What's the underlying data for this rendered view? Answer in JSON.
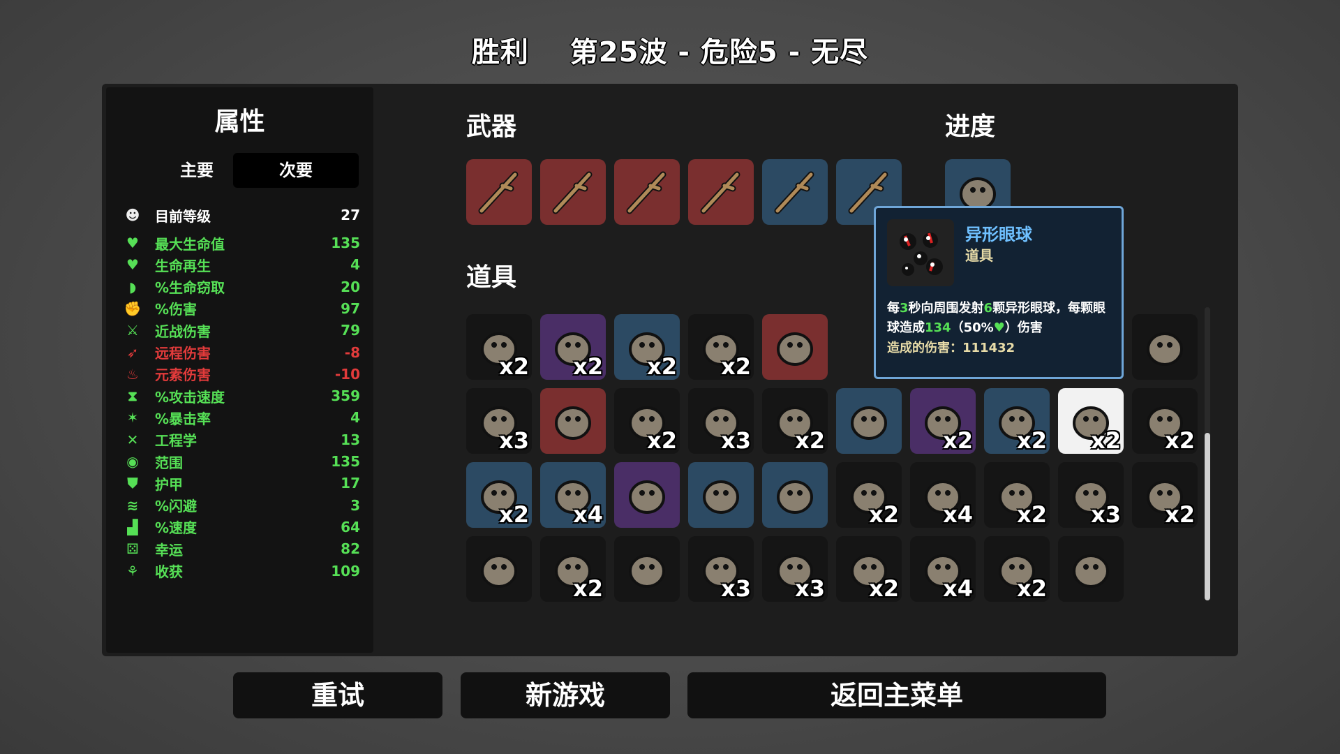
{
  "header": {
    "result": "胜利",
    "wave_info": "第25波 - 危险5 - 无尽"
  },
  "stats_panel": {
    "title": "属性",
    "tabs": [
      "主要",
      "次要"
    ],
    "rows": [
      {
        "name": "目前等级",
        "value": "27",
        "color": "#ffffff",
        "icon": "level-icon"
      },
      {
        "name": "最大生命值",
        "value": "135",
        "color": "#56e056",
        "icon": "heart-icon"
      },
      {
        "name": "生命再生",
        "value": "4",
        "color": "#56e056",
        "icon": "heart-plus-icon"
      },
      {
        "name": "%生命窃取",
        "value": "20",
        "color": "#56e056",
        "icon": "fangs-icon"
      },
      {
        "name": "%伤害",
        "value": "97",
        "color": "#56e056",
        "icon": "muscle-icon"
      },
      {
        "name": "近战伤害",
        "value": "79",
        "color": "#56e056",
        "icon": "sword-icon"
      },
      {
        "name": "远程伤害",
        "value": "-8",
        "color": "#e23b3b",
        "icon": "bow-icon"
      },
      {
        "name": "元素伤害",
        "value": "-10",
        "color": "#e23b3b",
        "icon": "fire-icon"
      },
      {
        "name": "%攻击速度",
        "value": "359",
        "color": "#56e056",
        "icon": "hourglass-icon"
      },
      {
        "name": "%暴击率",
        "value": "4",
        "color": "#56e056",
        "icon": "crit-icon"
      },
      {
        "name": "工程学",
        "value": "13",
        "color": "#56e056",
        "icon": "wrench-icon"
      },
      {
        "name": "范围",
        "value": "135",
        "color": "#56e056",
        "icon": "range-icon"
      },
      {
        "name": "护甲",
        "value": "17",
        "color": "#56e056",
        "icon": "shield-icon"
      },
      {
        "name": "%闪避",
        "value": "3",
        "color": "#56e056",
        "icon": "dodge-icon"
      },
      {
        "name": "%速度",
        "value": "64",
        "color": "#56e056",
        "icon": "boot-icon"
      },
      {
        "name": "幸运",
        "value": "82",
        "color": "#56e056",
        "icon": "dice-icon"
      },
      {
        "name": "收获",
        "value": "109",
        "color": "#56e056",
        "icon": "harvest-icon"
      }
    ]
  },
  "weapons": {
    "title": "武器",
    "items": [
      {
        "icon": "stick-icon",
        "tier_color": "#7a2f2f"
      },
      {
        "icon": "stick-icon",
        "tier_color": "#7a2f2f"
      },
      {
        "icon": "stick-icon",
        "tier_color": "#7a2f2f"
      },
      {
        "icon": "stick-icon",
        "tier_color": "#7a2f2f"
      },
      {
        "icon": "stick-icon",
        "tier_color": "#2c4a63"
      },
      {
        "icon": "stick-icon",
        "tier_color": "#2c4a63"
      }
    ]
  },
  "progress": {
    "title": "进度",
    "items": [
      {
        "icon": "coin-pouch-icon",
        "tier_color": "#2c4a63"
      }
    ]
  },
  "items_section": {
    "title": "道具",
    "rows": [
      [
        {
          "icon": "claw-meat-icon",
          "bg": "#151515",
          "count": "x2"
        },
        {
          "icon": "skull-pile-icon",
          "bg": "#4a2e66",
          "count": "x2"
        },
        {
          "icon": "worm-icon",
          "bg": "#2c4a63",
          "count": "x2"
        },
        {
          "icon": "leaf-bag-icon",
          "bg": "#151515",
          "count": "x2"
        },
        {
          "icon": "robot-icon",
          "bg": "#7a2f2f",
          "count": ""
        },
        {
          "icon": "helmet-icon",
          "bg": "#4a2e66",
          "count": ""
        },
        {
          "icon": "hidden",
          "bg": "#151515",
          "count": ""
        },
        {
          "icon": "hidden",
          "bg": "#151515",
          "count": ""
        },
        {
          "icon": "hidden",
          "bg": "#151515",
          "count": ""
        },
        {
          "icon": "butterfly-icon",
          "bg": "#151515",
          "count": ""
        }
      ],
      [
        {
          "icon": "lemonade-icon",
          "bg": "#151515",
          "count": "x3"
        },
        {
          "icon": "mammoth-icon",
          "bg": "#7a2f2f",
          "count": ""
        },
        {
          "icon": "syringe-icon",
          "bg": "#151515",
          "count": "x2"
        },
        {
          "icon": "tree-icon",
          "bg": "#151515",
          "count": "x3"
        },
        {
          "icon": "coffee-icon",
          "bg": "#151515",
          "count": "x2"
        },
        {
          "icon": "potion-icon",
          "bg": "#2c4a63",
          "count": ""
        },
        {
          "icon": "tractor-icon",
          "bg": "#4a2e66",
          "count": "x2"
        },
        {
          "icon": "scarf-icon",
          "bg": "#2c4a63",
          "count": "x2"
        },
        {
          "icon": "alien-eyes-icon",
          "bg": "#f2f2f2",
          "count": "x2"
        },
        {
          "icon": "bandage-icon",
          "bg": "#151515",
          "count": "x2"
        }
      ],
      [
        {
          "icon": "bomb-icon",
          "bg": "#2c4a63",
          "count": "x2"
        },
        {
          "icon": "necklace-icon",
          "bg": "#2c4a63",
          "count": "x4"
        },
        {
          "icon": "sprout-icon",
          "bg": "#4a2e66",
          "count": ""
        },
        {
          "icon": "turret-icon",
          "bg": "#2c4a63",
          "count": ""
        },
        {
          "icon": "piggy-bank-icon",
          "bg": "#2c4a63",
          "count": ""
        },
        {
          "icon": "black-helmet-icon",
          "bg": "#151515",
          "count": "x2"
        },
        {
          "icon": "monkey-icon",
          "bg": "#151515",
          "count": "x4"
        },
        {
          "icon": "horn-icon",
          "bg": "#151515",
          "count": "x2"
        },
        {
          "icon": "goat-skull-icon",
          "bg": "#151515",
          "count": "x3"
        },
        {
          "icon": "red-glove-icon",
          "bg": "#151515",
          "count": "x2"
        }
      ],
      [
        {
          "icon": "cash-icon",
          "bg": "#151515",
          "count": ""
        },
        {
          "icon": "propeller-hat-icon",
          "bg": "#151515",
          "count": "x2"
        },
        {
          "icon": "poop-icon",
          "bg": "#151515",
          "count": ""
        },
        {
          "icon": "snail-icon",
          "bg": "#151515",
          "count": "x3"
        },
        {
          "icon": "glasses-icon",
          "bg": "#151515",
          "count": "x3"
        },
        {
          "icon": "head-icon",
          "bg": "#151515",
          "count": "x2"
        },
        {
          "icon": "syringe-purple-icon",
          "bg": "#151515",
          "count": "x4"
        },
        {
          "icon": "ghost-icon",
          "bg": "#151515",
          "count": "x2"
        },
        {
          "icon": "plaid-shirt-icon",
          "bg": "#151515",
          "count": ""
        }
      ]
    ]
  },
  "tooltip": {
    "name": "异形眼球",
    "type": "道具",
    "desc_parts": [
      "每",
      "3",
      "秒向周围发射",
      "6",
      "颗异形眼球，每颗眼球造成",
      "134",
      "（50%",
      "♥",
      "）伤害"
    ],
    "damage": "造成的伤害：111432"
  },
  "buttons": {
    "retry": "重试",
    "new_game": "新游戏",
    "main_menu": "返回主菜单"
  }
}
